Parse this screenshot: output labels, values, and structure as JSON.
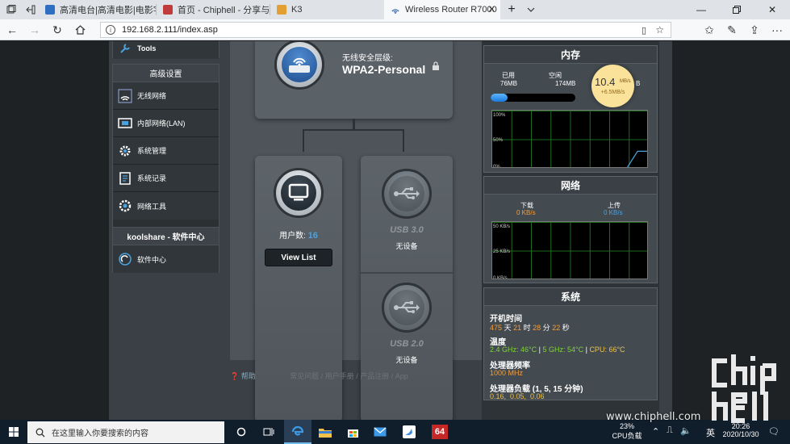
{
  "browser": {
    "tabs": [
      {
        "title": ""
      },
      {
        "title": "高清电台|高清电影|电影字幕"
      },
      {
        "title": "首页 - Chiphell - 分享与交流"
      },
      {
        "title": "K3"
      },
      {
        "title": "Wireless Router R7000 ·",
        "active": true
      }
    ],
    "url": "192.168.2.111/index.asp"
  },
  "sidebar": {
    "top_item": "Tools",
    "advanced_title": "高级设置",
    "items": [
      {
        "label": "无线网络",
        "icon": "wifi-icon"
      },
      {
        "label": "内部网络(LAN)",
        "icon": "lan-icon"
      },
      {
        "label": "系统管理",
        "icon": "gear-icon"
      },
      {
        "label": "系统记录",
        "icon": "log-icon"
      },
      {
        "label": "网络工具",
        "icon": "network-tools-icon"
      }
    ],
    "koolshare_title": "koolshare - 软件中心",
    "koolshare_item": "软件中心"
  },
  "main": {
    "security_label": "无线安全层级:",
    "security_value": "WPA2-Personal",
    "clients_label": "用户数:",
    "clients_count": "16",
    "view_list": "View List",
    "usb3_label": "USB 3.0",
    "usb3_status": "无设备",
    "usb2_label": "USB 2.0",
    "usb2_status": "无设备"
  },
  "footer": {
    "help": "帮助",
    "links": "常见问题 / 用户手册 / 产品注册 / App"
  },
  "memory": {
    "title": "内存",
    "used_label": "已用",
    "used_value": "76MB",
    "free_label": "空闲",
    "free_value": "174MB",
    "total_suffix": "B",
    "usage_fraction": 0.2,
    "graph_labels": [
      "100%",
      "50%",
      "0%"
    ],
    "graph_values": [
      0,
      0,
      0,
      0,
      0,
      0,
      0,
      0,
      0,
      0,
      0,
      0,
      0,
      30,
      30
    ]
  },
  "speed_bubble": {
    "value": "10.4",
    "unit": "MB/s",
    "delta": "+6.5MB/s"
  },
  "network": {
    "title": "网络",
    "down_label": "下载",
    "down_value": "0 KB/s",
    "up_label": "上传",
    "up_value": "0 KB/s",
    "graph_labels": [
      "50 KB/s",
      "25 KB/s",
      "0 KB/s"
    ]
  },
  "system": {
    "title": "系统",
    "uptime_label": "开机时间",
    "uptime": {
      "days": "475",
      "d": "天",
      "hours": "21",
      "h": "时",
      "minutes": "28",
      "m": "分",
      "seconds": "22",
      "s": "秒"
    },
    "temp_label": "温度",
    "temp_24": "2.4 GHz: 46°C",
    "temp_5": "5 GHz: 54°C",
    "temp_cpu": "CPU: 66°C",
    "freq_label": "处理器频率",
    "freq_value": "1000 MHz",
    "load_label": "处理器负载 (1, 5, 15 分钟)",
    "load_value": "0.16,  0.05,  0.06"
  },
  "taskbar": {
    "search_placeholder": "在这里输入你要搜索的内容",
    "cpu_percent": "23%",
    "cpu_label": "CPU负载",
    "ime": "英",
    "time": "20:26",
    "date": "2020/10/30",
    "badge": "64"
  },
  "watermark": {
    "text": "www.chiphell.com"
  },
  "colors": {
    "accent_blue": "#4aa3df",
    "orange": "#f59d3a",
    "green": "#7fd33a",
    "yellow": "#f0c24a"
  }
}
